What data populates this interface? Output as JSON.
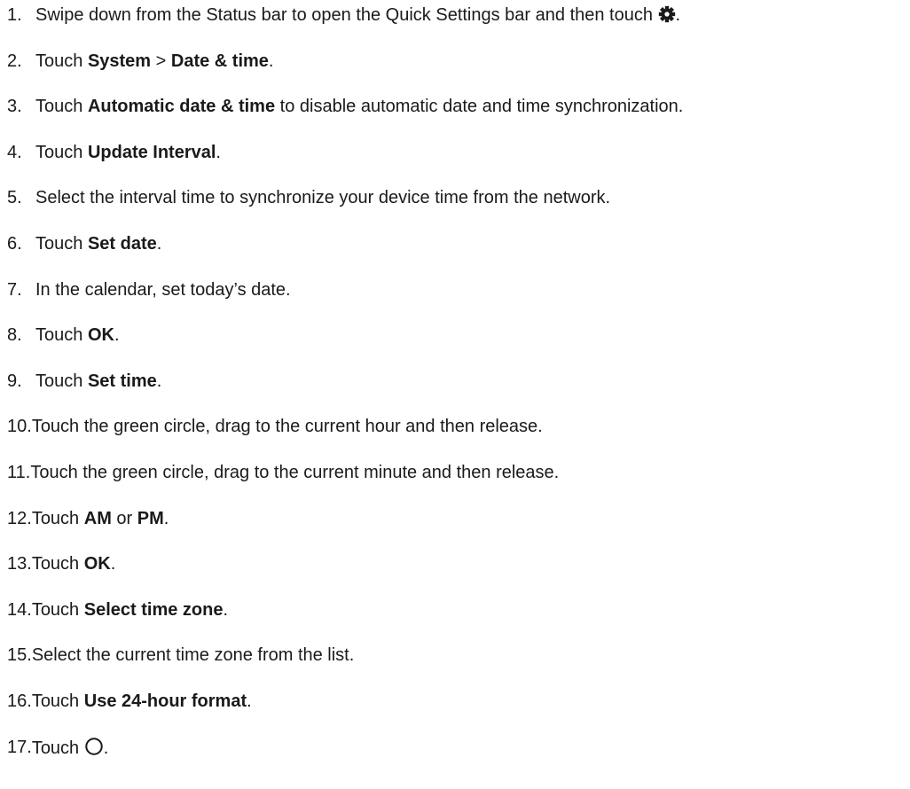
{
  "steps": [
    {
      "number": "1.",
      "parts": [
        {
          "t": "text",
          "v": "Swipe down from the Status bar to open the Quick Settings bar and then touch "
        },
        {
          "t": "icon",
          "v": "gear-icon"
        },
        {
          "t": "text",
          "v": "."
        }
      ]
    },
    {
      "number": "2.",
      "parts": [
        {
          "t": "text",
          "v": "Touch "
        },
        {
          "t": "bold",
          "v": "System"
        },
        {
          "t": "text",
          "v": " > "
        },
        {
          "t": "bold",
          "v": "Date & time"
        },
        {
          "t": "text",
          "v": "."
        }
      ]
    },
    {
      "number": "3.",
      "parts": [
        {
          "t": "text",
          "v": "Touch "
        },
        {
          "t": "bold",
          "v": "Automatic date & time"
        },
        {
          "t": "text",
          "v": " to disable automatic date and time synchronization."
        }
      ]
    },
    {
      "number": "4.",
      "parts": [
        {
          "t": "text",
          "v": "Touch "
        },
        {
          "t": "bold",
          "v": "Update Interval"
        },
        {
          "t": "text",
          "v": "."
        }
      ]
    },
    {
      "number": "5.",
      "parts": [
        {
          "t": "text",
          "v": "Select the interval time to synchronize your device time from the network."
        }
      ]
    },
    {
      "number": "6.",
      "parts": [
        {
          "t": "text",
          "v": "Touch "
        },
        {
          "t": "bold",
          "v": "Set date"
        },
        {
          "t": "text",
          "v": "."
        }
      ]
    },
    {
      "number": "7.",
      "parts": [
        {
          "t": "text",
          "v": "In the calendar, set today’s date."
        }
      ]
    },
    {
      "number": "8.",
      "parts": [
        {
          "t": "text",
          "v": "Touch "
        },
        {
          "t": "bold",
          "v": "OK"
        },
        {
          "t": "text",
          "v": "."
        }
      ]
    },
    {
      "number": "9.",
      "parts": [
        {
          "t": "text",
          "v": "Touch "
        },
        {
          "t": "bold",
          "v": "Set time"
        },
        {
          "t": "text",
          "v": "."
        }
      ]
    },
    {
      "number": "10.",
      "parts": [
        {
          "t": "text",
          "v": "Touch the green circle, drag to the current hour and then release."
        }
      ]
    },
    {
      "number": "11.",
      "parts": [
        {
          "t": "text",
          "v": "Touch the green circle, drag to the current minute and then release."
        }
      ]
    },
    {
      "number": "12.",
      "parts": [
        {
          "t": "text",
          "v": "Touch "
        },
        {
          "t": "bold",
          "v": "AM"
        },
        {
          "t": "text",
          "v": " or "
        },
        {
          "t": "bold",
          "v": "PM"
        },
        {
          "t": "text",
          "v": "."
        }
      ]
    },
    {
      "number": "13.",
      "parts": [
        {
          "t": "text",
          "v": "Touch "
        },
        {
          "t": "bold",
          "v": "OK"
        },
        {
          "t": "text",
          "v": "."
        }
      ]
    },
    {
      "number": "14.",
      "parts": [
        {
          "t": "text",
          "v": "Touch "
        },
        {
          "t": "bold",
          "v": "Select time zone"
        },
        {
          "t": "text",
          "v": "."
        }
      ]
    },
    {
      "number": "15.",
      "parts": [
        {
          "t": "text",
          "v": "Select the current time zone from the list."
        }
      ]
    },
    {
      "number": "16.",
      "parts": [
        {
          "t": "text",
          "v": "Touch "
        },
        {
          "t": "bold",
          "v": "Use 24-hour format"
        },
        {
          "t": "text",
          "v": "."
        }
      ]
    },
    {
      "number": "17.",
      "parts": [
        {
          "t": "text",
          "v": "Touch "
        },
        {
          "t": "icon",
          "v": "home-circle-icon"
        },
        {
          "t": "text",
          "v": "."
        }
      ]
    }
  ]
}
